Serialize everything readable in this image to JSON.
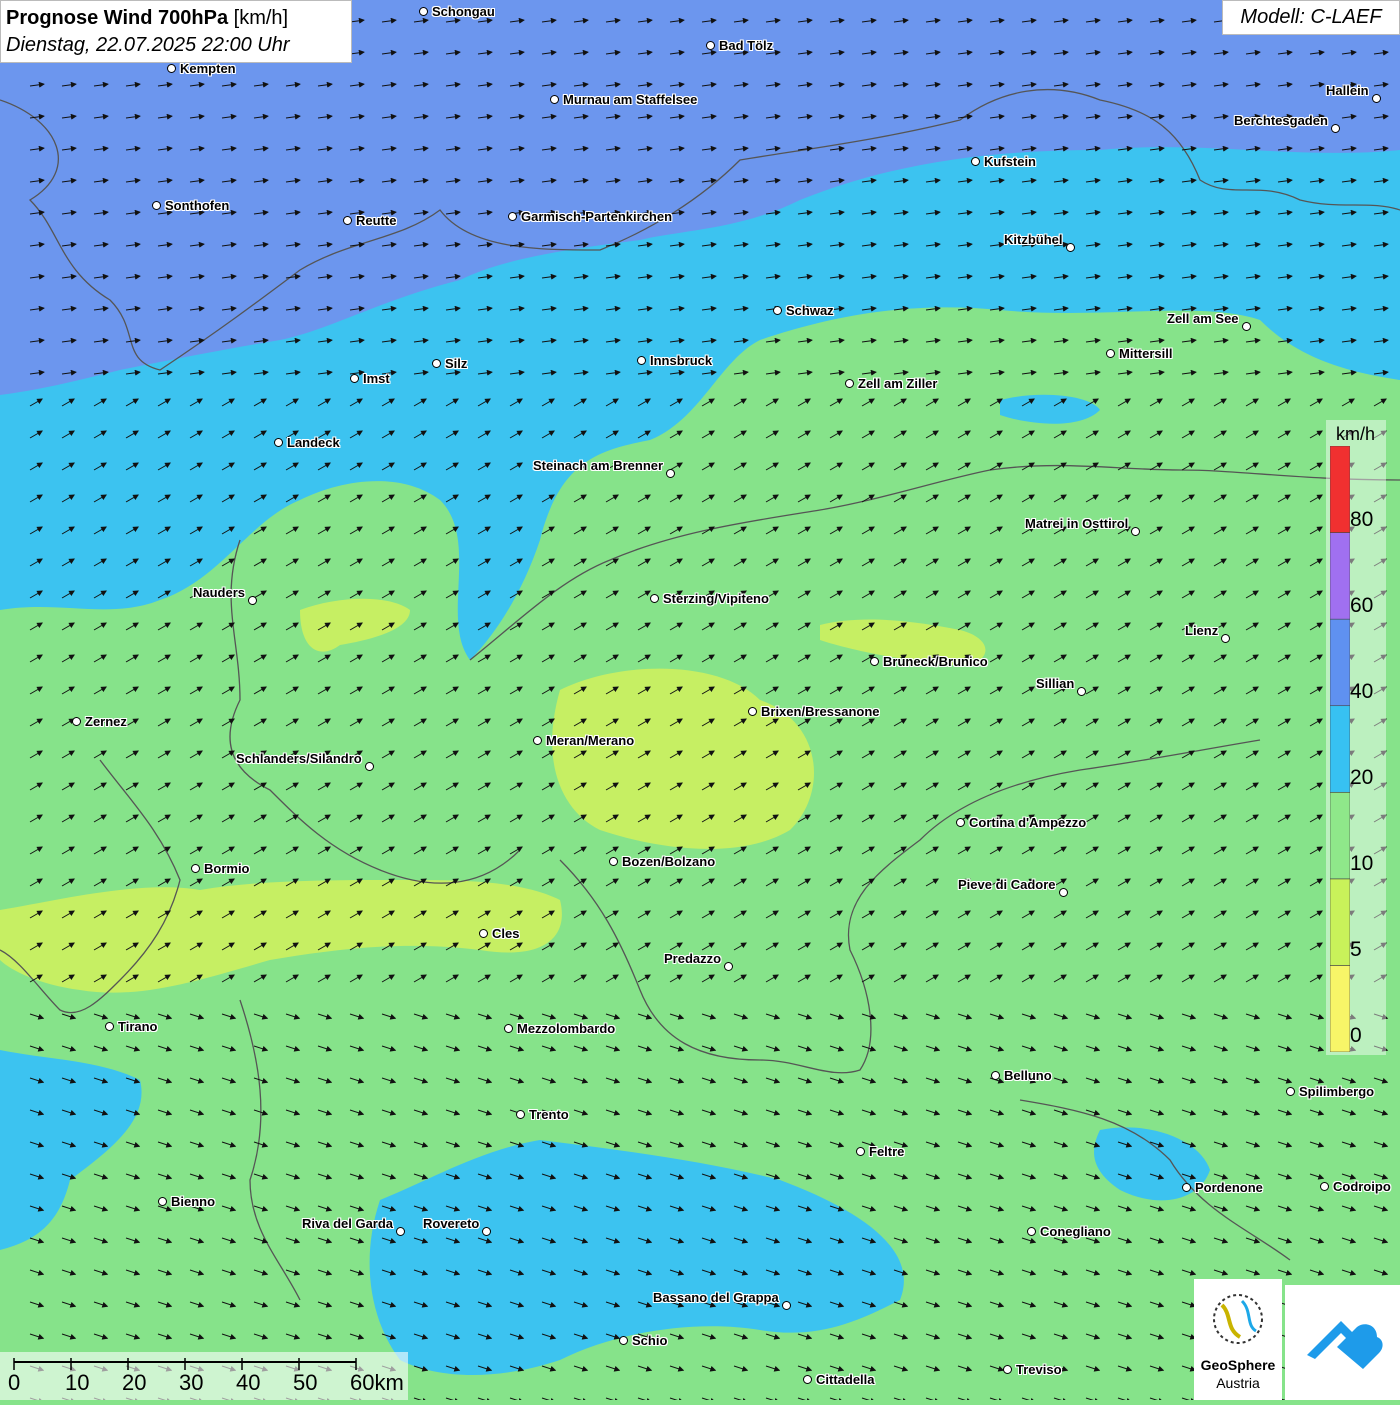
{
  "header": {
    "title_bold": "Prognose Wind 700hPa",
    "title_unit": "[km/h]",
    "datetime": "Dienstag, 22.07.2025 22:00 Uhr",
    "model": "Modell: C-LAEF"
  },
  "legend": {
    "unit": "km/h",
    "labels": [
      "0",
      "5",
      "10",
      "20",
      "40",
      "60",
      "80"
    ],
    "colors": [
      "#f7f568",
      "#c9f25a",
      "#8fe88a",
      "#37c1f2",
      "#5f91f0",
      "#a070f0",
      "#f03030"
    ]
  },
  "scale_bar": {
    "labels": [
      "0",
      "10",
      "20",
      "30",
      "40",
      "50",
      "60km"
    ]
  },
  "logo": {
    "line1": "GeoSphere",
    "line2": "Austria"
  },
  "cities": [
    {
      "name": "Schongau"
    },
    {
      "name": "Bad Tölz"
    },
    {
      "name": "Kempten"
    },
    {
      "name": "Murnau am Staffelsee"
    },
    {
      "name": "Hallein"
    },
    {
      "name": "Berchtesgaden"
    },
    {
      "name": "Kufstein"
    },
    {
      "name": "Sonthofen"
    },
    {
      "name": "Reutte"
    },
    {
      "name": "Garmisch-Partenkirchen"
    },
    {
      "name": "Kitzbühel"
    },
    {
      "name": "Schwaz"
    },
    {
      "name": "Zell am See"
    },
    {
      "name": "Mittersill"
    },
    {
      "name": "Innsbruck"
    },
    {
      "name": "Silz"
    },
    {
      "name": "Imst"
    },
    {
      "name": "Zell am Ziller"
    },
    {
      "name": "Landeck"
    },
    {
      "name": "Steinach am Brenner"
    },
    {
      "name": "Matrei in Osttirol"
    },
    {
      "name": "Nauders"
    },
    {
      "name": "Sterzing/Vipiteno"
    },
    {
      "name": "Lienz"
    },
    {
      "name": "Bruneck/Brunico"
    },
    {
      "name": "Sillian"
    },
    {
      "name": "Zernez"
    },
    {
      "name": "Brixen/Bressanone"
    },
    {
      "name": "Meran/Merano"
    },
    {
      "name": "Schlanders/Silandro"
    },
    {
      "name": "Cortina d'Ampezzo"
    },
    {
      "name": "Bormio"
    },
    {
      "name": "Bozen/Bolzano"
    },
    {
      "name": "Pieve di Cadore"
    },
    {
      "name": "Cles"
    },
    {
      "name": "Predazzo"
    },
    {
      "name": "Tirano"
    },
    {
      "name": "Mezzolombardo"
    },
    {
      "name": "Belluno"
    },
    {
      "name": "Spilimbergo"
    },
    {
      "name": "Trento"
    },
    {
      "name": "Feltre"
    },
    {
      "name": "Pordenone"
    },
    {
      "name": "Codroipo"
    },
    {
      "name": "Bienno"
    },
    {
      "name": "Riva del Garda"
    },
    {
      "name": "Rovereto"
    },
    {
      "name": "Conegliano"
    },
    {
      "name": "Bassano del Grappa"
    },
    {
      "name": "Schio"
    },
    {
      "name": "Treviso"
    },
    {
      "name": "Cittadella"
    }
  ]
}
